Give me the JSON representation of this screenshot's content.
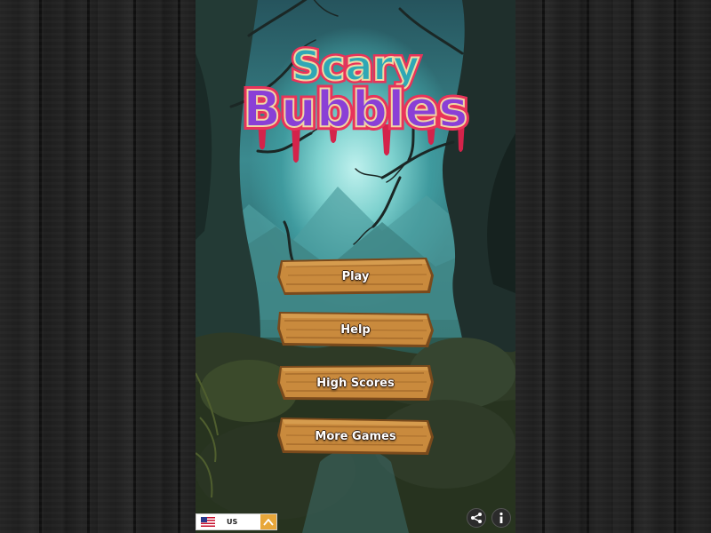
{
  "game": {
    "title_line1": "Scary",
    "title_line2": "Bubbles"
  },
  "menu": {
    "play": "Play",
    "help": "Help",
    "high_scores": "High Scores",
    "more_games": "More Games"
  },
  "language": {
    "code": "US",
    "flag_icon": "us-flag-icon",
    "toggle_icon": "chevron-up-icon"
  },
  "footer_icons": {
    "share": "share-icon",
    "info": "info-icon"
  },
  "colors": {
    "title_top_fill": "#2fa7b5",
    "title_bottom_fill": "#8a3fd6",
    "title_outline": "#e8335a",
    "sign_wood": "#c98a3d",
    "background_side": "#232323"
  }
}
